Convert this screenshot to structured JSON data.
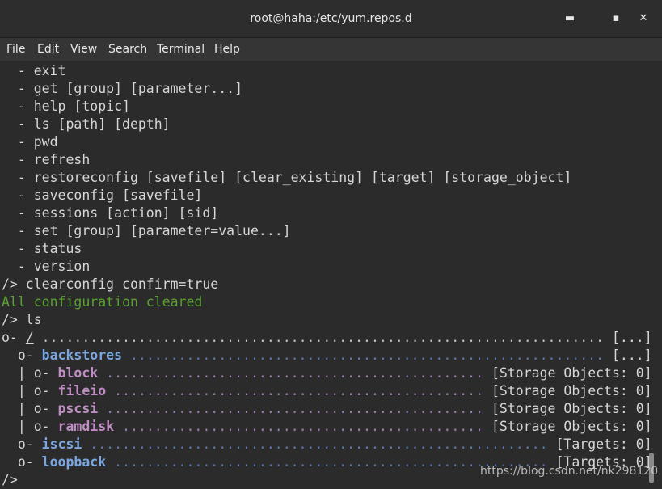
{
  "window": {
    "title": "root@haha:/etc/yum.repos.d",
    "minimize_glyph": "▬",
    "maximize_glyph": "▪",
    "close_glyph": "✕"
  },
  "menu": [
    "File",
    "Edit",
    "View",
    "Search",
    "Terminal",
    "Help"
  ],
  "help_commands": [
    "  - exit",
    "  - get [group] [parameter...]",
    "  - help [topic]",
    "  - ls [path] [depth]",
    "  - pwd",
    "  - refresh",
    "  - restoreconfig [savefile] [clear_existing] [target] [storage_object]",
    "  - saveconfig [savefile]",
    "  - sessions [action] [sid]",
    "  - set [group] [parameter=value...]",
    "  - status",
    "  - version"
  ],
  "session": {
    "cmd1": "/> clearconfig confirm=true",
    "cmd1_output": "All configuration cleared",
    "cmd2": "/> ls",
    "final_prompt": "/>"
  },
  "tree": {
    "root": {
      "prefix": "o- ",
      "name": "/",
      "dots": " ...................................................................... ",
      "info": "[...]"
    },
    "backstores": {
      "prefix": "  o- ",
      "name": "backstores",
      "dots": " ........................................................... ",
      "info": "[...]"
    },
    "block": {
      "prefix": "  | o- ",
      "name": "block",
      "dots": " ............................................... ",
      "info": "[Storage Objects: 0]"
    },
    "fileio": {
      "prefix": "  | o- ",
      "name": "fileio",
      "dots": " .............................................. ",
      "info": "[Storage Objects: 0]"
    },
    "pscsi": {
      "prefix": "  | o- ",
      "name": "pscsi",
      "dots": " ............................................... ",
      "info": "[Storage Objects: 0]"
    },
    "ramdisk": {
      "prefix": "  | o- ",
      "name": "ramdisk",
      "dots": " ............................................. ",
      "info": "[Storage Objects: 0]"
    },
    "iscsi": {
      "prefix": "  o- ",
      "name": "iscsi",
      "dots": " ......................................................... ",
      "info": "[Targets: 0]"
    },
    "loopback": {
      "prefix": "  o- ",
      "name": "loopback",
      "dots": " ...................................................... ",
      "info": "[Targets: 0]"
    }
  },
  "watermark": "https://blog.csdn.net/nk298120"
}
